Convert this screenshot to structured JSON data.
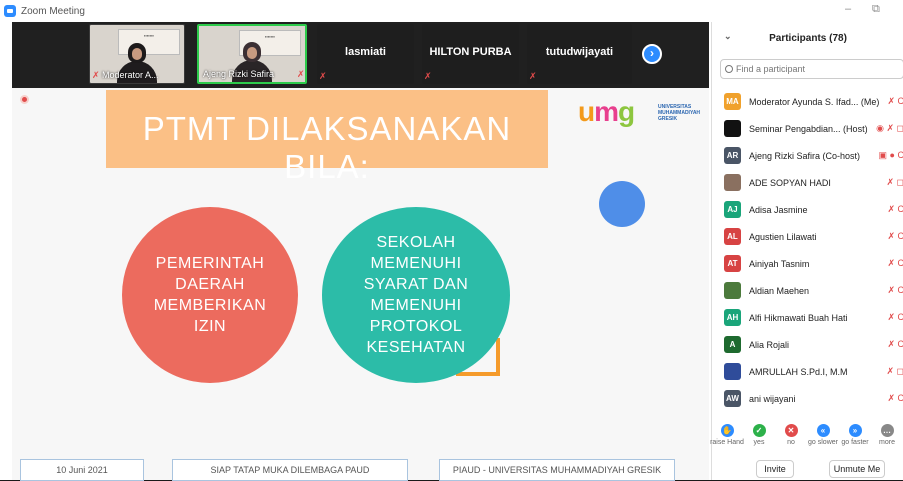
{
  "window": {
    "title": "Zoom Meeting",
    "minimize_icon": "–",
    "restore_icon": "⧉"
  },
  "strip": {
    "tiles": [
      {
        "kind": "video",
        "caption": "Moderator A..."
      },
      {
        "kind": "video",
        "caption": "Ajeng Rizki Safira"
      },
      {
        "kind": "name",
        "label": "lasmiati"
      },
      {
        "kind": "name",
        "label": "HILTON PURBA"
      },
      {
        "kind": "name",
        "label": "tutudwijayati"
      }
    ],
    "next_icon": "›"
  },
  "slide": {
    "title": "PTMT DILAKSANAKAN BILA:",
    "logo_text": "umg",
    "logo_sub": "UNIVERSITAS\nMUHAMMADIYAH\nGRESIK",
    "circle_left": "PEMERINTAH DAERAH MEMBERIKAN IZIN",
    "circle_right": "SEKOLAH MEMENUHI SYARAT DAN MEMENUHI PROTOKOL KESEHATAN",
    "footer": [
      "10 Juni 2021",
      "SIAP TATAP MUKA DILEMBAGA PAUD",
      "PIAUD - UNIVERSITAS MUHAMMADIYAH GRESIK"
    ]
  },
  "panel": {
    "title": "Participants (78)",
    "search_placeholder": "Find a participant",
    "participants": [
      {
        "initials": "MA",
        "name": "Moderator Ayunda S. Ifad...  (Me)",
        "color": "#f0a12c",
        "icons": "✗ C"
      },
      {
        "initials": "",
        "name": "Seminar Pengabdian... (Host)",
        "color": "#111111",
        "icons": "◉ ✗ ◻"
      },
      {
        "initials": "AR",
        "name": "Ajeng Rizki Safira (Co-host)",
        "color": "#4a5566",
        "icons": "▣ ● C"
      },
      {
        "initials": "",
        "name": "ADE SOPYAN HADI",
        "color": "#8a7060",
        "icons": "✗ ◻"
      },
      {
        "initials": "AJ",
        "name": "Adisa Jasmine",
        "color": "#1aa57a",
        "icons": "✗ C"
      },
      {
        "initials": "AL",
        "name": "Agustien Lilawati",
        "color": "#d74343",
        "icons": "✗ C"
      },
      {
        "initials": "AT",
        "name": "Ainiyah Tasnim",
        "color": "#d74343",
        "icons": "✗ C"
      },
      {
        "initials": "",
        "name": "Aldian Maehen",
        "color": "#4c7a3c",
        "icons": "✗ C"
      },
      {
        "initials": "AH",
        "name": "Alfi Hikmawati Buah Hati",
        "color": "#1aa57a",
        "icons": "✗ C"
      },
      {
        "initials": "A",
        "name": "Alia Rojali",
        "color": "#1e6a2f",
        "icons": "✗ C"
      },
      {
        "initials": "",
        "name": "AMRULLAH S.Pd.I, M.M",
        "color": "#2f4c9a",
        "icons": "✗ ◻"
      },
      {
        "initials": "AW",
        "name": "ani wijayani",
        "color": "#4a5566",
        "icons": "✗ C"
      }
    ],
    "reactions": [
      {
        "label": "raise Hand",
        "color": "#2d8cff",
        "glyph": "✋"
      },
      {
        "label": "yes",
        "color": "#2db14a",
        "glyph": "✓"
      },
      {
        "label": "no",
        "color": "#e14b4b",
        "glyph": "✕"
      },
      {
        "label": "go slower",
        "color": "#2d8cff",
        "glyph": "«"
      },
      {
        "label": "go faster",
        "color": "#2d8cff",
        "glyph": "»"
      },
      {
        "label": "more",
        "color": "#888888",
        "glyph": "…"
      }
    ],
    "invite_label": "Invite",
    "unmute_label": "Unmute Me"
  }
}
